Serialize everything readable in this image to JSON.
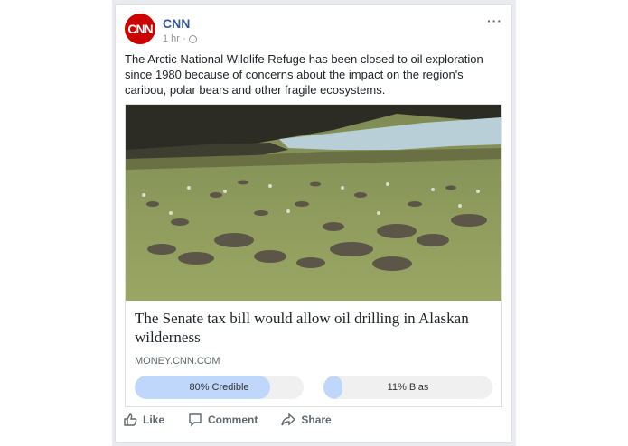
{
  "post": {
    "page_name": "CNN",
    "avatar_text": "CNN",
    "time": "1 hr",
    "time_separator": "·",
    "more": "···",
    "text": "The Arctic National Wildlife Refuge has been closed to oil exploration since 1980 because of concerns about the impact on the region's caribou, polar bears and other fragile ecosystems.",
    "link": {
      "title": "The Senate tax bill would allow oil drilling in Alaskan wilderness",
      "domain": "MONEY.CNN.COM"
    },
    "meters": {
      "credible": {
        "label": "80% Credible",
        "fraction": 0.8
      },
      "bias": {
        "label": "11% Bias",
        "fraction": 0.11
      }
    },
    "actions": {
      "like": "Like",
      "comment": "Comment",
      "share": "Share"
    }
  },
  "colors": {
    "brand_red": "#cc0000",
    "link_blue": "#365899",
    "meter_fill": "#bfd7fb"
  }
}
